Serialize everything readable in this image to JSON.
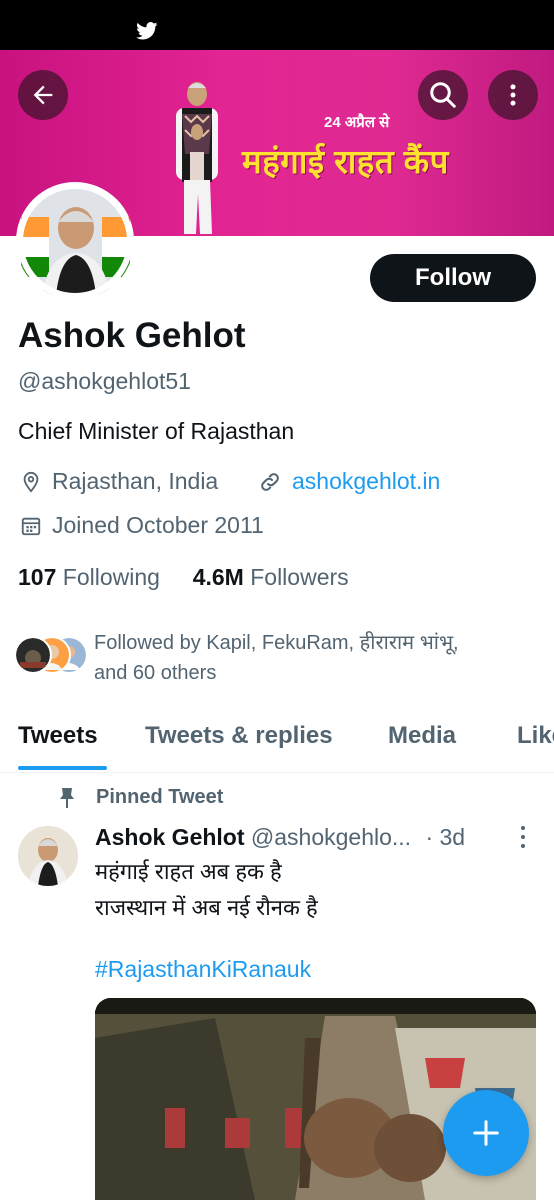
{
  "banner": {
    "date_text": "24 अप्रैल से",
    "camp_text": "महंगाई राहत कैंप",
    "color": "#e0248f"
  },
  "header": {
    "back_icon": "arrow-left-icon",
    "search_icon": "search-icon",
    "more_icon": "more-vertical-icon"
  },
  "profile": {
    "follow_label": "Follow",
    "name": "Ashok Gehlot",
    "handle": "@ashokgehlot51",
    "bio": "Chief Minister of Rajasthan",
    "location": "Rajasthan, India",
    "website": "ashokgehlot.in",
    "joined": "Joined October 2011",
    "following_count": "107",
    "following_label": "Following",
    "followers_count": "4.6M",
    "followers_label": "Followers",
    "followed_by_line1": "Followed by Kapil, FekuRam, हीराराम भांभू,",
    "followed_by_line2": "and 60 others"
  },
  "tabs": [
    {
      "label": "Tweets",
      "active": true
    },
    {
      "label": "Tweets & replies",
      "active": false
    },
    {
      "label": "Media",
      "active": false
    },
    {
      "label": "Likes",
      "active": false
    }
  ],
  "tweet": {
    "pinned_label": "Pinned Tweet",
    "author": "Ashok Gehlot",
    "handle": "@ashokgehlo...",
    "time": "· 3d",
    "line1": "महंगाई राहत अब हक है",
    "line2": "राजस्थान में अब नई रौनक है",
    "hashtag": "#RajasthanKiRanauk"
  },
  "colors": {
    "accent": "#1d9bf0",
    "text": "#0f1419",
    "secondary": "#536471"
  }
}
